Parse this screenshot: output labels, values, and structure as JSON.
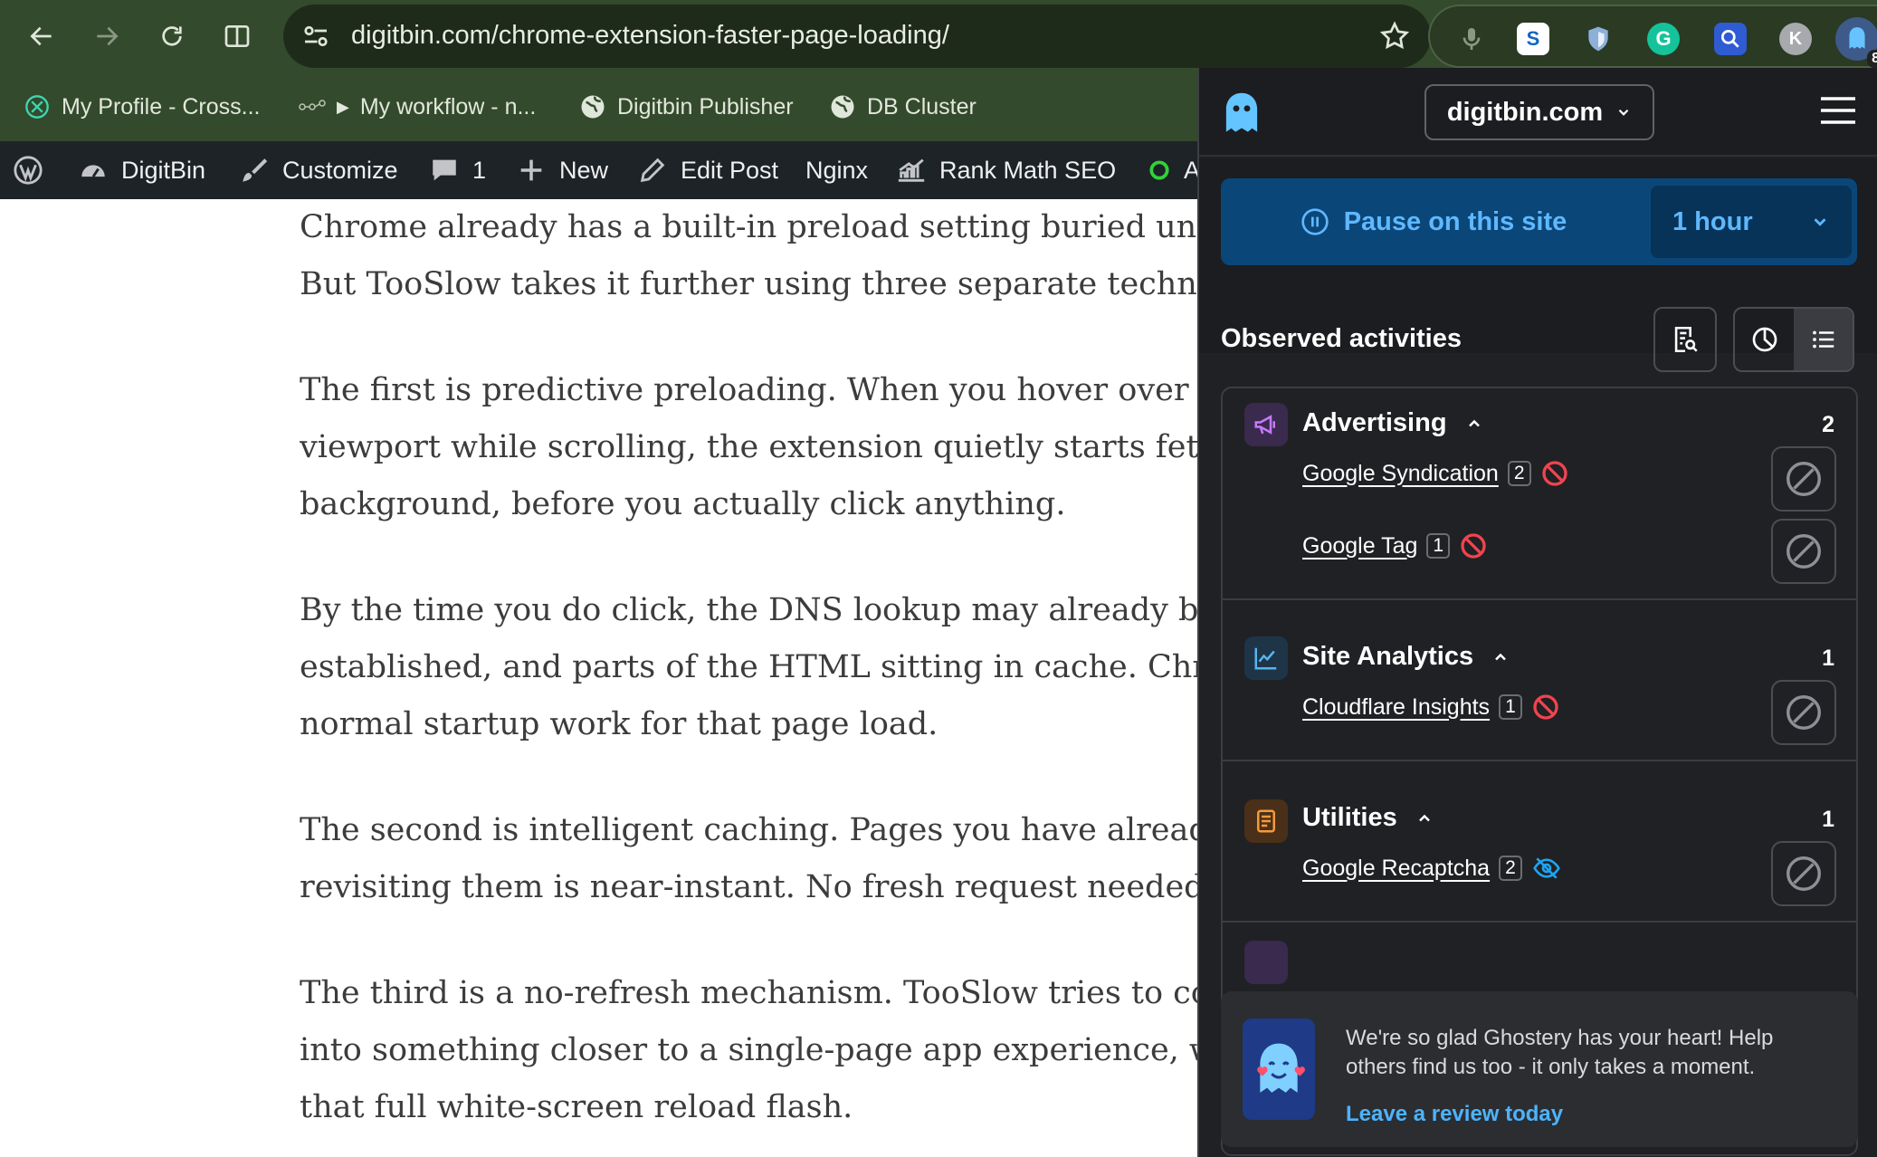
{
  "browser": {
    "url": "digitbin.com/chrome-extension-faster-page-loading/",
    "ghostery_badge": "8",
    "profile_initial": "K"
  },
  "bookmarks": [
    {
      "label": "My Profile - Cross..."
    },
    {
      "label": "My workflow - n..."
    },
    {
      "label": "Digitbin Publisher"
    },
    {
      "label": "DB Cluster"
    }
  ],
  "wpbar": {
    "site": "DigitBin",
    "customize": "Customize",
    "comments": "1",
    "new": "New",
    "edit": "Edit Post",
    "nginx": "Nginx",
    "rankmath": "Rank Math SEO",
    "cut": "A"
  },
  "article": {
    "p1": [
      "Chrome already has a built-in preload setting buried under",
      "But TooSlow takes it further using three separate technique"
    ],
    "p2": [
      "The first is predictive preloading. When you hover over a li",
      "viewport while scrolling, the extension quietly starts fetchi",
      "background, before you actually click anything."
    ],
    "p3": [
      "By the time you do click, the DNS lookup may already be re",
      "established, and parts of the HTML sitting in cache. Chrome",
      "normal startup work for that page load."
    ],
    "p4": [
      "The second is intelligent caching. Pages you have already vi",
      "revisiting them is near-instant. No fresh request needed for"
    ],
    "p5": [
      "The third is a no-refresh mechanism. TooSlow tries to conv",
      "into something closer to a single-page app experience, with",
      "that full white-screen reload flash."
    ]
  },
  "ghostery": {
    "domain": "digitbin.com",
    "pause_label": "Pause on this site",
    "pause_duration": "1 hour",
    "observed_title": "Observed activities",
    "categories": [
      {
        "name": "Advertising",
        "count": "2",
        "color": "#b46cf2",
        "trackers": [
          {
            "name": "Google Syndication",
            "count": "2",
            "status": "blocked"
          },
          {
            "name": "Google Tag",
            "count": "1",
            "status": "blocked"
          }
        ]
      },
      {
        "name": "Site Analytics",
        "count": "1",
        "color": "#4aa8e8",
        "trackers": [
          {
            "name": "Cloudflare Insights",
            "count": "1",
            "status": "blocked"
          }
        ]
      },
      {
        "name": "Utilities",
        "count": "1",
        "color": "#f59a3a",
        "trackers": [
          {
            "name": "Google Recaptcha",
            "count": "2",
            "status": "modified"
          }
        ]
      }
    ],
    "toast_text": "We're so glad Ghostery has your heart! Help others find us too - it only takes a moment.",
    "toast_link": "Leave a review today"
  }
}
